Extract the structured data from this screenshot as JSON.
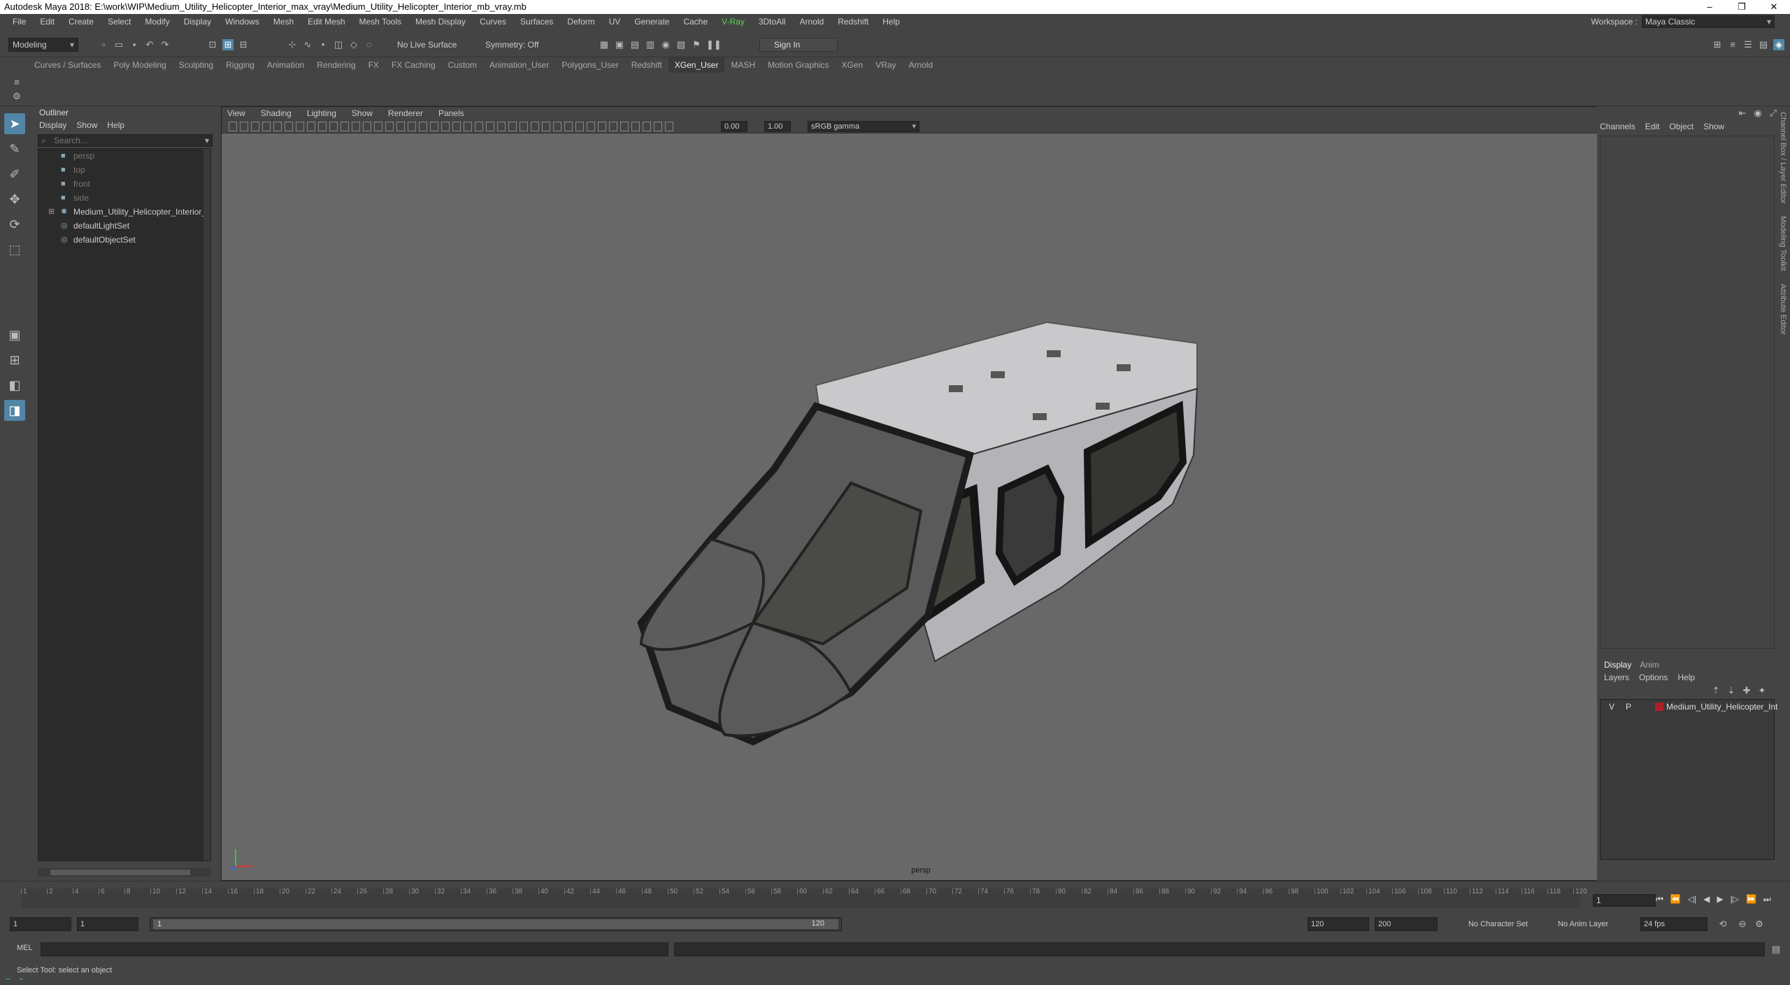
{
  "title": "Autodesk Maya 2018: E:\\work\\WIP\\Medium_Utility_Helicopter_Interior_max_vray\\Medium_Utility_Helicopter_Interior_mb_vray.mb",
  "window_controls": {
    "minimize": "–",
    "restore": "❐",
    "close": "✕"
  },
  "menubar": [
    "File",
    "Edit",
    "Create",
    "Select",
    "Modify",
    "Display",
    "Windows",
    "Mesh",
    "Edit Mesh",
    "Mesh Tools",
    "Mesh Display",
    "Curves",
    "Surfaces",
    "Deform",
    "UV",
    "Generate",
    "Cache",
    "V-Ray",
    "3DtoAll",
    "Arnold",
    "Redshift",
    "Help"
  ],
  "workspace": {
    "label": "Workspace :",
    "value": "Maya Classic"
  },
  "statusline": {
    "mode": "Modeling",
    "live_surface": "No Live Surface",
    "symmetry": "Symmetry: Off",
    "sign_in": "Sign In"
  },
  "shelf_tabs": [
    "Curves / Surfaces",
    "Poly Modeling",
    "Sculpting",
    "Rigging",
    "Animation",
    "Rendering",
    "FX",
    "FX Caching",
    "Custom",
    "Animation_User",
    "Polygons_User",
    "Redshift",
    "XGen_User",
    "MASH",
    "Motion Graphics",
    "XGen",
    "VRay",
    "Arnold"
  ],
  "active_shelf_tab": "XGen_User",
  "outliner": {
    "title": "Outliner",
    "menu": [
      "Display",
      "Show",
      "Help"
    ],
    "search_placeholder": "Search...",
    "items": [
      {
        "label": "persp",
        "dim": true,
        "icon": "camera-icon"
      },
      {
        "label": "top",
        "dim": true,
        "icon": "camera-icon"
      },
      {
        "label": "front",
        "dim": true,
        "icon": "camera-icon"
      },
      {
        "label": "side",
        "dim": true,
        "icon": "camera-icon"
      },
      {
        "label": "Medium_Utility_Helicopter_Interior_n",
        "dim": false,
        "icon": "group-icon",
        "expandable": true
      },
      {
        "label": "defaultLightSet",
        "dim": false,
        "icon": "set-icon"
      },
      {
        "label": "defaultObjectSet",
        "dim": false,
        "icon": "set-icon"
      }
    ]
  },
  "viewport": {
    "menu": [
      "View",
      "Shading",
      "Lighting",
      "Show",
      "Renderer",
      "Panels"
    ],
    "exposure": "0.00",
    "gamma": "1.00",
    "color_space": "sRGB gamma",
    "camera_label": "persp"
  },
  "channel_box": {
    "menu": [
      "Channels",
      "Edit",
      "Object",
      "Show"
    ],
    "side_tabs": [
      "Channel Box / Layer Editor",
      "Modeling Toolkit",
      "Attribute Editor"
    ]
  },
  "layer_editor": {
    "tabs": [
      "Display",
      "Anim"
    ],
    "menu": [
      "Layers",
      "Options",
      "Help"
    ],
    "layers": [
      {
        "v": "V",
        "p": "P",
        "name": "Medium_Utility_Helicopter_Int",
        "color": "#b0202a"
      }
    ]
  },
  "timeline": {
    "ticks": [
      "1",
      "2",
      "4",
      "6",
      "8",
      "10",
      "12",
      "14",
      "16",
      "18",
      "20",
      "22",
      "24",
      "26",
      "28",
      "30",
      "32",
      "34",
      "36",
      "38",
      "40",
      "42",
      "44",
      "46",
      "48",
      "50",
      "52",
      "54",
      "56",
      "58",
      "60",
      "62",
      "64",
      "66",
      "68",
      "70",
      "72",
      "74",
      "76",
      "78",
      "80",
      "82",
      "84",
      "86",
      "88",
      "90",
      "92",
      "94",
      "96",
      "98",
      "100",
      "102",
      "104",
      "106",
      "108",
      "110",
      "112",
      "114",
      "116",
      "118",
      "120"
    ],
    "current_frame": "1"
  },
  "range": {
    "start": "1",
    "playback_start": "1",
    "slider_start": "1",
    "slider_end": "120",
    "playback_end": "120",
    "end": "200",
    "character_set": "No Character Set",
    "anim_layer": "No Anim Layer",
    "fps": "24 fps"
  },
  "command_line": {
    "label": "MEL"
  },
  "help_line": "Select Tool: select an object"
}
